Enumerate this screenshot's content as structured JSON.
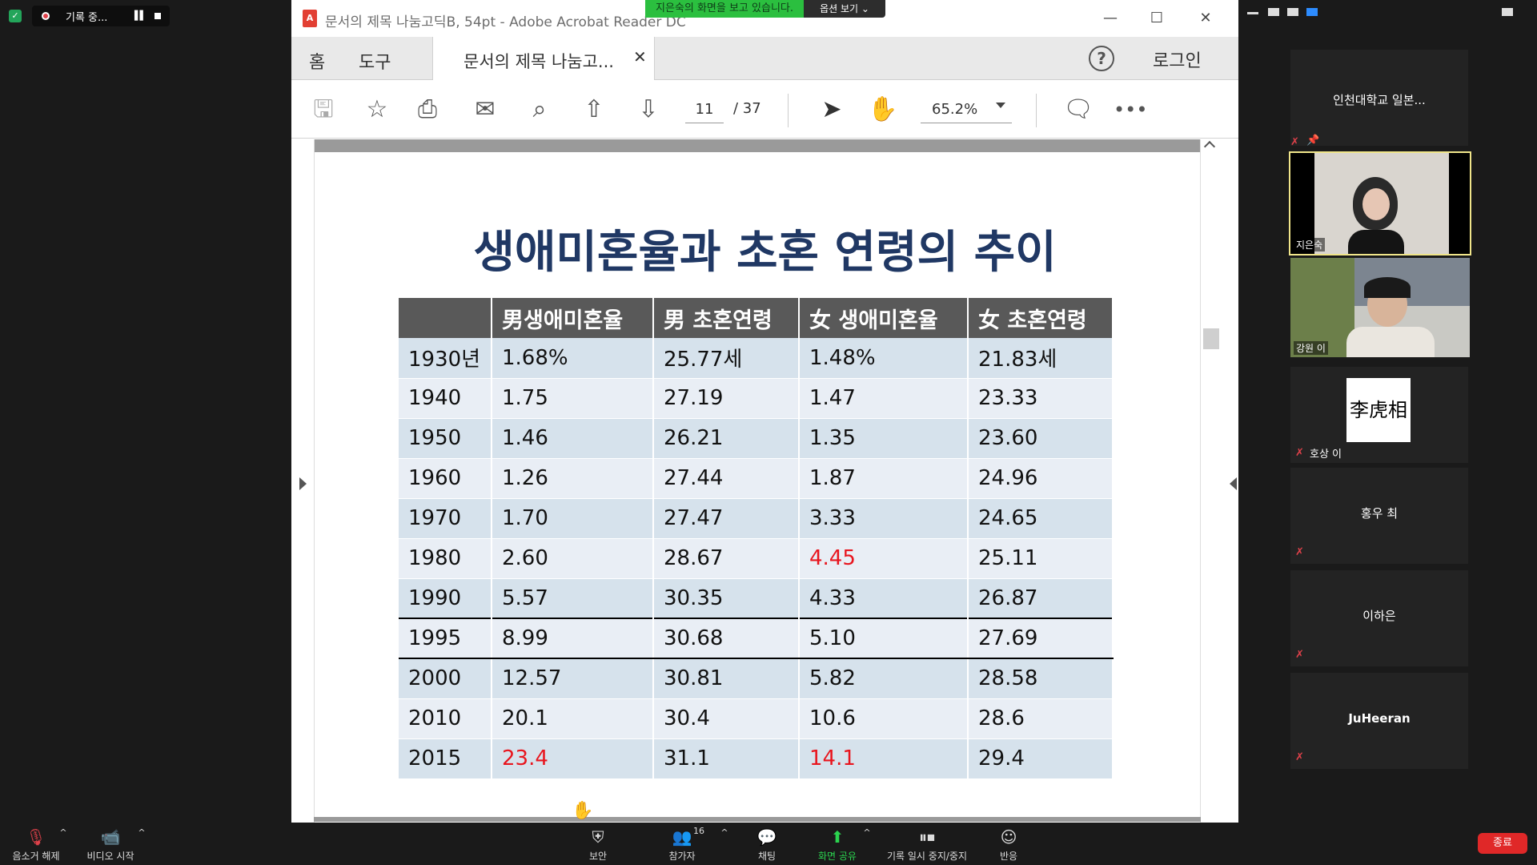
{
  "recording": {
    "label": "기록 중..."
  },
  "acrobat": {
    "window_title": "문서의 제목 나눔고딕B, 54pt - Adobe Acrobat Reader DC",
    "share_banner": "지은숙의 화면을 보고 있습니다.",
    "share_options": "옵션 보기 ⌄",
    "tabs": {
      "home": "홈",
      "tools": "도구",
      "document": "문서의 제목 나눔고..."
    },
    "login": "로그인",
    "page_current": "11",
    "page_total": "/ 37",
    "zoom": "65.2%"
  },
  "slide": {
    "title": "생애미혼율과 초혼 연령의 추이",
    "headers": [
      "",
      "男생애미혼율",
      "男 초혼연령",
      "女 생애미혼율",
      "女 초혼연령"
    ],
    "rows": [
      [
        "1930년",
        "1.68%",
        "25.77세",
        "1.48%",
        "21.83세"
      ],
      [
        "1940",
        "1.75",
        "27.19",
        "1.47",
        "23.33"
      ],
      [
        "1950",
        "1.46",
        "26.21",
        "1.35",
        "23.60"
      ],
      [
        "1960",
        "1.26",
        "27.44",
        "1.87",
        "24.96"
      ],
      [
        "1970",
        "1.70",
        "27.47",
        "3.33",
        "24.65"
      ],
      [
        "1980",
        "2.60",
        "28.67",
        "4.45",
        "25.11"
      ],
      [
        "1990",
        "5.57",
        "30.35",
        "4.33",
        "26.87"
      ],
      [
        "1995",
        "8.99",
        "30.68",
        "5.10",
        "27.69"
      ],
      [
        "2000",
        "12.57",
        "30.81",
        "5.82",
        "28.58"
      ],
      [
        "2010",
        "20.1",
        "30.4",
        "10.6",
        "28.6"
      ],
      [
        "2015",
        "23.4",
        "31.1",
        "14.1",
        "29.4"
      ]
    ],
    "highlight_color": "#e8151e"
  },
  "participants": {
    "header_name": "인천대학교 일본...",
    "video1_name": "지은숙",
    "video2_name": "강원 이",
    "avatar_text": "李虎相",
    "p3_name": "호상 이",
    "p4_name": "홍우 최",
    "p5_name": "이하은",
    "p6_name": "JuHeeran"
  },
  "zoombar": {
    "unmute": "음소거 해제",
    "video": "비디오 시작",
    "security": "보안",
    "participants": "참가자",
    "participants_count": "16",
    "chat": "채팅",
    "share": "화면 공유",
    "record": "기록 일시 중지/중지",
    "reactions": "반응",
    "end": "종료"
  }
}
